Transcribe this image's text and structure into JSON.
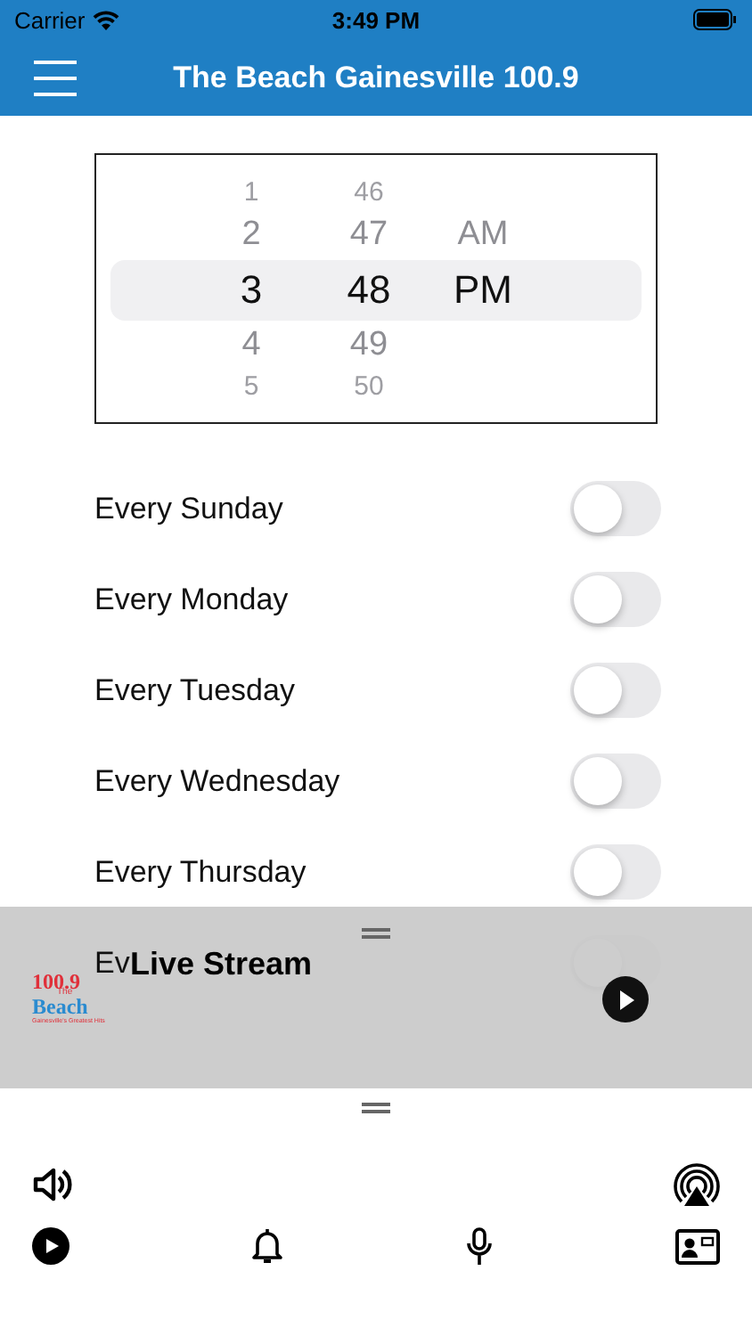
{
  "status_bar": {
    "carrier": "Carrier",
    "time": "3:49 PM"
  },
  "nav": {
    "title": "The Beach Gainesville 100.9"
  },
  "picker": {
    "columns": [
      {
        "items": [
          {
            "text": "1",
            "selected": false
          },
          {
            "text": "2",
            "selected": false
          },
          {
            "text": "3",
            "selected": true
          },
          {
            "text": "4",
            "selected": false
          },
          {
            "text": "5",
            "selected": false
          }
        ]
      },
      {
        "items": [
          {
            "text": "46",
            "selected": false
          },
          {
            "text": "47",
            "selected": false
          },
          {
            "text": "48",
            "selected": true
          },
          {
            "text": "49",
            "selected": false
          },
          {
            "text": "50",
            "selected": false
          }
        ]
      },
      {
        "items": [
          {
            "text": "AM",
            "selected": false
          },
          {
            "text": "PM",
            "selected": true
          }
        ]
      }
    ]
  },
  "alarms": [
    {
      "label": "Every Sunday",
      "on": false
    },
    {
      "label": "Every Monday",
      "on": false
    },
    {
      "label": "Every Tuesday",
      "on": false
    },
    {
      "label": "Every Wednesday",
      "on": false
    },
    {
      "label": "Every Thursday",
      "on": false
    },
    {
      "label": "Ev",
      "on": false
    }
  ],
  "player": {
    "title": "Live Stream",
    "logo": {
      "number": "100.9",
      "the": "The",
      "name": "Beach",
      "tagline": "Gainesville's Greatest Hits"
    }
  }
}
